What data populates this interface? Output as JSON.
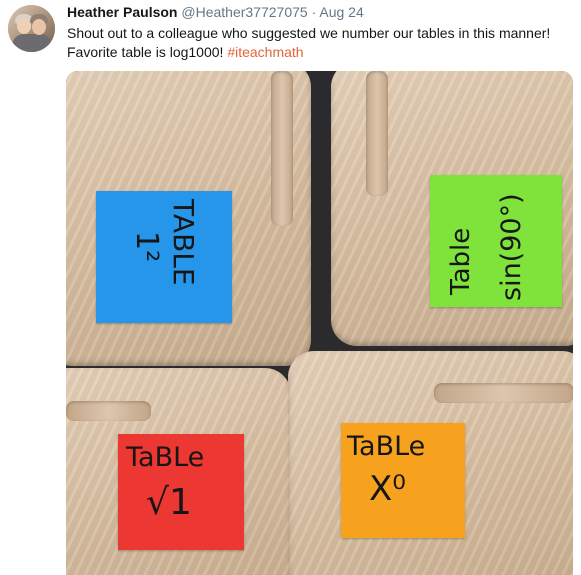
{
  "tweet": {
    "author_name": "Heather Paulson",
    "handle": "@Heather37727075",
    "separator": "·",
    "date": "Aug 24",
    "text_line1": "Shout out to a colleague who suggested we number our tables in this manner!",
    "text_line2": "Favorite table is log1000! ",
    "hashtag": "#iteachmath"
  },
  "photo": {
    "notes": [
      {
        "color": "#2596ea",
        "word": "TABLE",
        "value": "1²"
      },
      {
        "color": "#7fe33b",
        "word": "Table",
        "value": "sin(90°)"
      },
      {
        "color": "#ec3732",
        "word": "TaBLe",
        "value": "√1"
      },
      {
        "color": "#f7a21f",
        "word": "TaBLe",
        "value": "X⁰"
      }
    ]
  }
}
